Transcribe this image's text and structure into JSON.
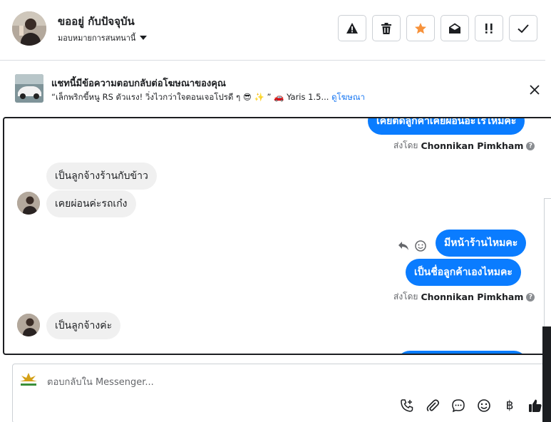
{
  "header": {
    "contact_name": "ขออยู่ กับปัจจุบัน",
    "assign_label": "มอบหมายการสนทนานี้",
    "actions": [
      "mark-spam",
      "delete",
      "star",
      "mark-unread",
      "follow-up",
      "done"
    ]
  },
  "ad_banner": {
    "title": "แชทนี้มีข้อความตอบกลับต่อโฆษณาของคุณ",
    "preview_text": "“เล็กพริกขี้หนู RS ตัวแรง! วิ่งไวกว่าใจตอนเจอโปรดี ๆ 😎 ✨ ” 🚗 Yaris 1.5...",
    "view_ad_link": "ดูโฆษณา"
  },
  "messages": [
    {
      "dir": "out",
      "text": "เคยติดลูกค้าเคยผ่อนอะไรไหมคะ"
    },
    {
      "dir": "meta",
      "sent_by_label": "ส่งโดย",
      "sender": "Chonnikan Pimkham"
    },
    {
      "dir": "in",
      "text": "เป็นลูกจ้างร้านกับข้าว"
    },
    {
      "dir": "in",
      "text": "เคยผ่อนค่ะรถเก๋ง"
    },
    {
      "dir": "out",
      "text": "มีหน้าร้านไหมคะ"
    },
    {
      "dir": "out",
      "text": "เป็นชื่อลูกค้าเองไหมคะ"
    },
    {
      "dir": "meta",
      "sent_by_label": "ส่งโดย",
      "sender": "Chonnikan Pimkham"
    },
    {
      "dir": "in",
      "text": "เป็นลูกจ้างค่ะ"
    }
  ],
  "composer": {
    "placeholder": "ตอบกลับใน Messenger...",
    "icons": [
      "call-add-icon",
      "attachment-icon",
      "chat-icon",
      "emoji-icon",
      "baht-icon",
      "like-icon"
    ],
    "currency_glyph": "฿"
  },
  "colors": {
    "outgoing": "#0a7cff",
    "incoming": "#f0f0f0",
    "star": "#f7923b"
  }
}
